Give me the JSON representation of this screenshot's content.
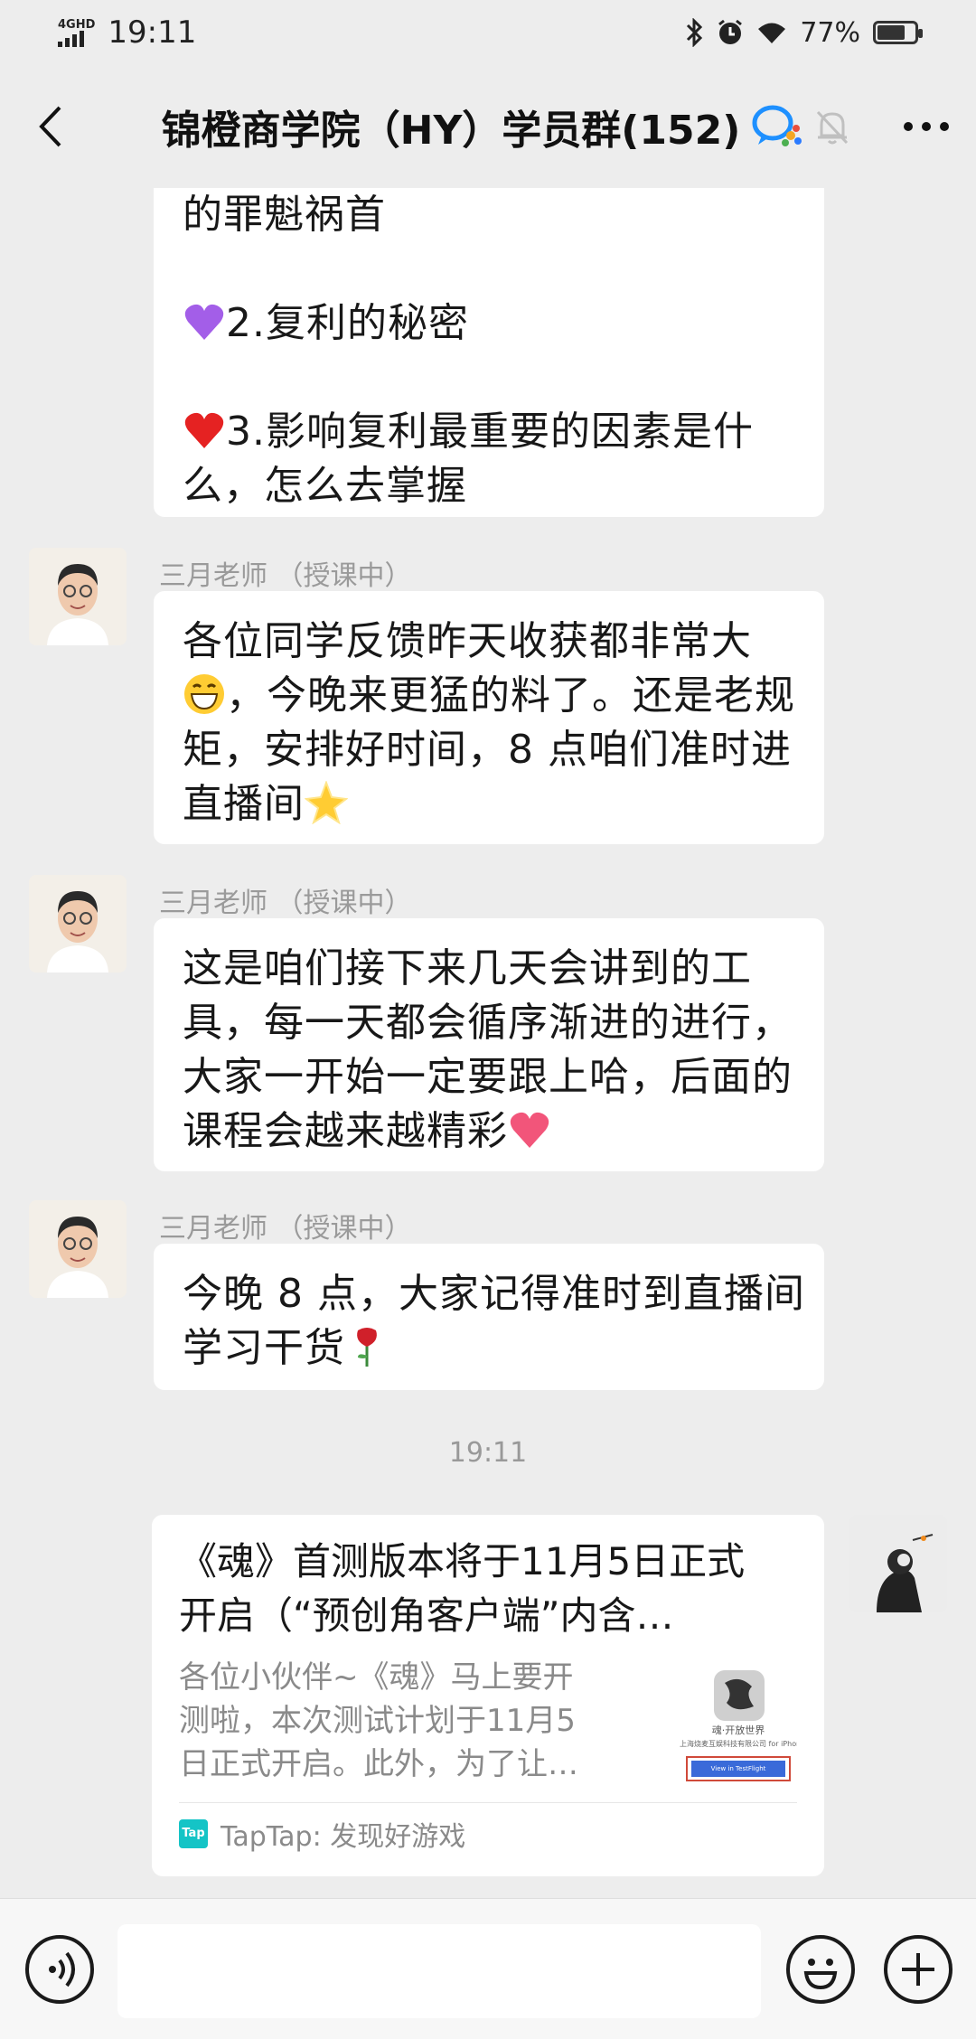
{
  "status_bar": {
    "network": "4GHD",
    "time": "19:11",
    "battery": "77%",
    "battery_level": 0.77
  },
  "header": {
    "title": "锦橙商学院（HY）学员群(152)"
  },
  "messages": [
    {
      "lines": [
        "的罪魁祸首",
        "",
        "2.复利的秘密",
        "",
        "3.影响复利最重要的因素是什",
        "么，怎么去掌握"
      ]
    },
    {
      "sender": "三月老师 （授课中）",
      "lines": [
        "各位同学反馈昨天收获都非常大",
        "，今晚来更猛的料了。还是老规",
        "矩，安排好时间，8 点咱们准时进",
        "直播间"
      ]
    },
    {
      "sender": "三月老师 （授课中）",
      "lines": [
        "这是咱们接下来几天会讲到的工",
        "具，每一天都会循序渐进的进行，",
        "大家一开始一定要跟上哈，后面的",
        "课程会越来越精彩"
      ]
    },
    {
      "sender": "三月老师 （授课中）",
      "lines": [
        "今晚 8 点，大家记得准时到直播间",
        "学习干货"
      ]
    }
  ],
  "time_divider": "19:11",
  "shared_card": {
    "title_lines": [
      "《魂》首测版本将于11月5日正式",
      "开启（“预创角客户端”内含…"
    ],
    "desc_lines": [
      "各位小伙伴~《魂》马上要开",
      "测啦，本次测试计划于11月5",
      "日正式开启。此外，为了让…"
    ],
    "thumb_text": "魂·开放世界",
    "thumb_sub": "上海烧麦互娱科技有限公司 for iPhone",
    "thumb_button": "View in TestFlight",
    "source_logo": "Tap",
    "source": "TapTap: 发现好游戏"
  },
  "input": {
    "value": ""
  },
  "colors": {
    "background": "#ededed",
    "bubble": "#ffffff",
    "taptap": "#14c4c6"
  }
}
